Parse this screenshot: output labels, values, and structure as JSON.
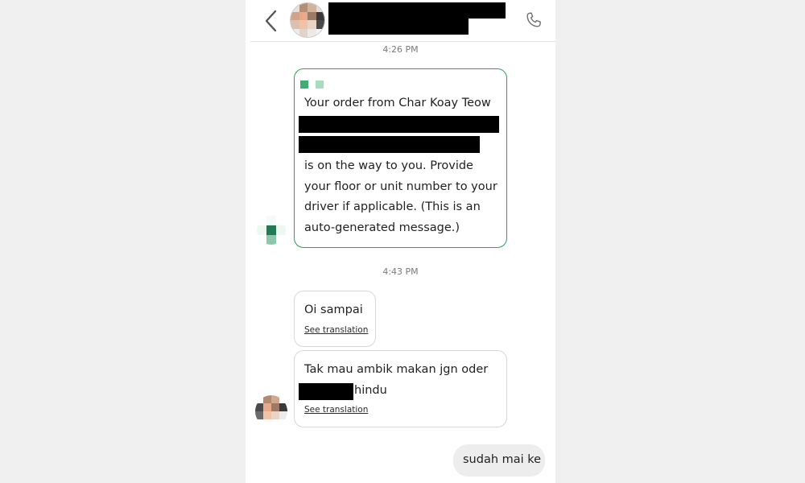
{
  "header": {
    "back_icon": "chevron-left-icon",
    "call_icon": "phone-icon"
  },
  "messages": {
    "time_1": "4:26 PM",
    "system": {
      "line_1": "Your order from Char Koay Teow",
      "line_2": "is on the way to you. Provide",
      "line_3": "your floor or unit number to your",
      "line_4": "driver if applicable. (This is an",
      "line_5": "auto-generated message.)"
    },
    "time_2": "4:43 PM",
    "received_1": {
      "text": "Oi sampai",
      "see_translation": "See translation"
    },
    "received_2": {
      "line_1": "Tak mau ambik makan jgn oder",
      "line_2_suffix": "hindu",
      "see_translation": "See translation"
    },
    "sent_1": {
      "text": "sudah mai ke"
    }
  },
  "colors": {
    "accent_green": "#23a456",
    "redaction": "#000000",
    "sent_bubble": "#ededed"
  }
}
